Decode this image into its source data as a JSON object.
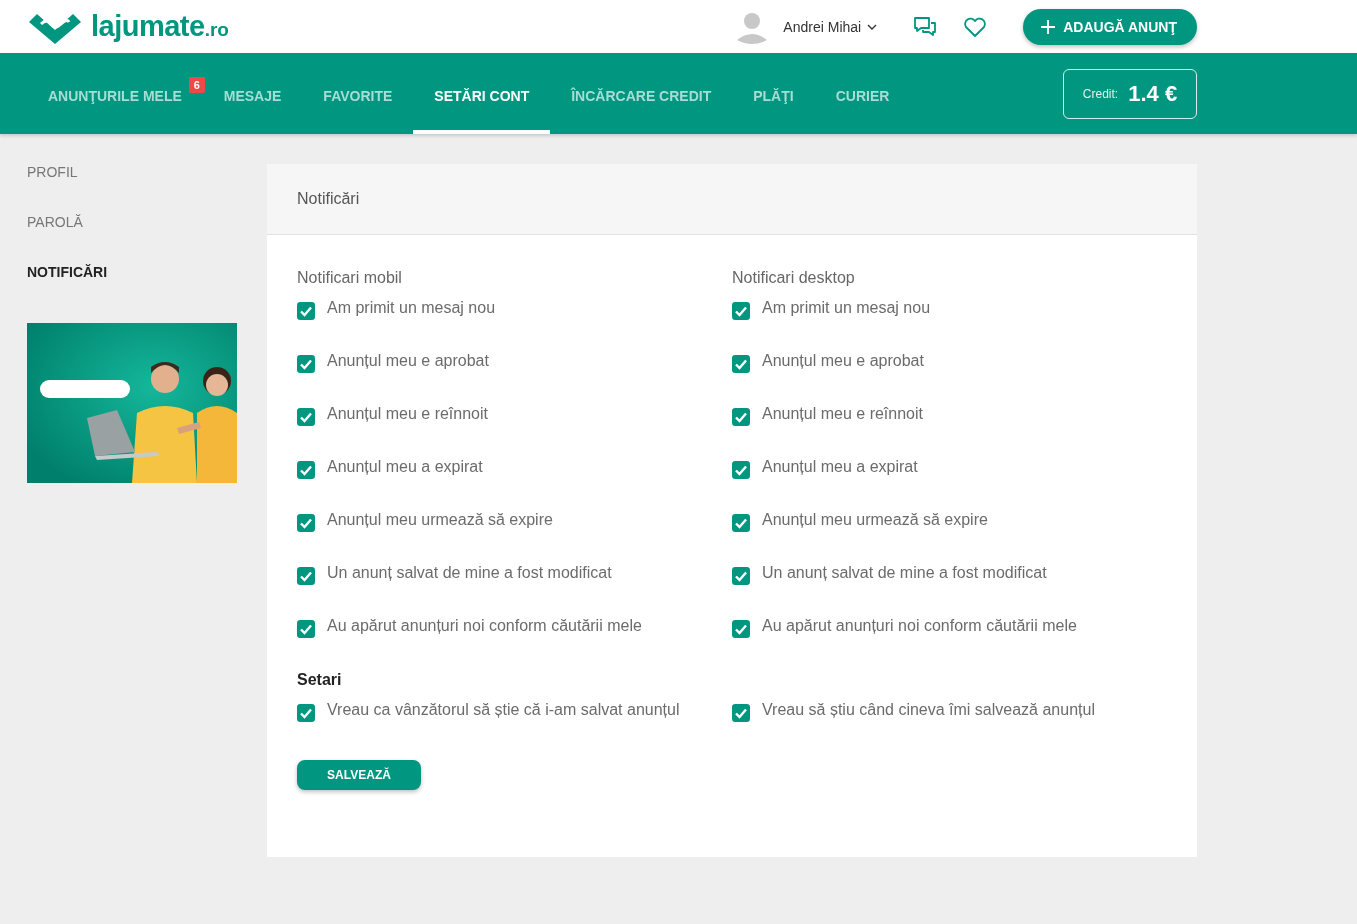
{
  "logo": {
    "name": "lajumate",
    "suffix": ".ro"
  },
  "user": {
    "name": "Andrei Mihai"
  },
  "add_button": {
    "label": "ADAUGĂ ANUNŢ"
  },
  "nav": {
    "tabs": [
      {
        "label": "ANUNŢURILE MELE",
        "selected": false,
        "badge": "6"
      },
      {
        "label": "MESAJE",
        "selected": false
      },
      {
        "label": "FAVORITE",
        "selected": false
      },
      {
        "label": "SETĂRI CONT",
        "selected": true
      },
      {
        "label": "ÎNCĂRCARE CREDIT",
        "selected": false
      },
      {
        "label": "PLĂŢI",
        "selected": false
      },
      {
        "label": "CURIER",
        "selected": false
      }
    ],
    "credit": {
      "label": "Credit:",
      "value": "1.4 €"
    }
  },
  "sidebar": {
    "items": [
      {
        "label": "PROFIL",
        "selected": false
      },
      {
        "label": "PAROLĂ",
        "selected": false
      },
      {
        "label": "NOTIFICĂRI",
        "selected": true
      }
    ]
  },
  "card": {
    "title": "Notificări",
    "columns": [
      {
        "heading": "Notificari mobil",
        "options": [
          {
            "label": "Am primit un mesaj nou",
            "checked": true
          },
          {
            "label": "Anunțul meu e aprobat",
            "checked": true
          },
          {
            "label": "Anunțul meu e reînnoit",
            "checked": true
          },
          {
            "label": "Anunțul meu a expirat",
            "checked": true
          },
          {
            "label": "Anunțul meu urmează să expire",
            "checked": true
          },
          {
            "label": "Un anunț salvat de mine a fost modificat",
            "checked": true
          },
          {
            "label": "Au apărut anunțuri noi conform căutării mele",
            "checked": true
          }
        ]
      },
      {
        "heading": "Notificari desktop",
        "options": [
          {
            "label": "Am primit un mesaj nou",
            "checked": true
          },
          {
            "label": "Anunțul meu e aprobat",
            "checked": true
          },
          {
            "label": "Anunțul meu e reînnoit",
            "checked": true
          },
          {
            "label": "Anunțul meu a expirat",
            "checked": true
          },
          {
            "label": "Anunțul meu urmează să expire",
            "checked": true
          },
          {
            "label": "Un anunț salvat de mine a fost modificat",
            "checked": true
          },
          {
            "label": "Au apărut anunțuri noi conform căutării mele",
            "checked": true
          }
        ]
      }
    ],
    "settings": {
      "heading": "Setari",
      "options": [
        {
          "label": "Vreau ca vânzătorul să știe că i-am salvat anunțul",
          "checked": true
        },
        {
          "label": "Vreau să știu când cineva îmi salvează anunțul",
          "checked": true
        }
      ]
    },
    "save_button": {
      "label": "SALVEAZĂ"
    }
  }
}
